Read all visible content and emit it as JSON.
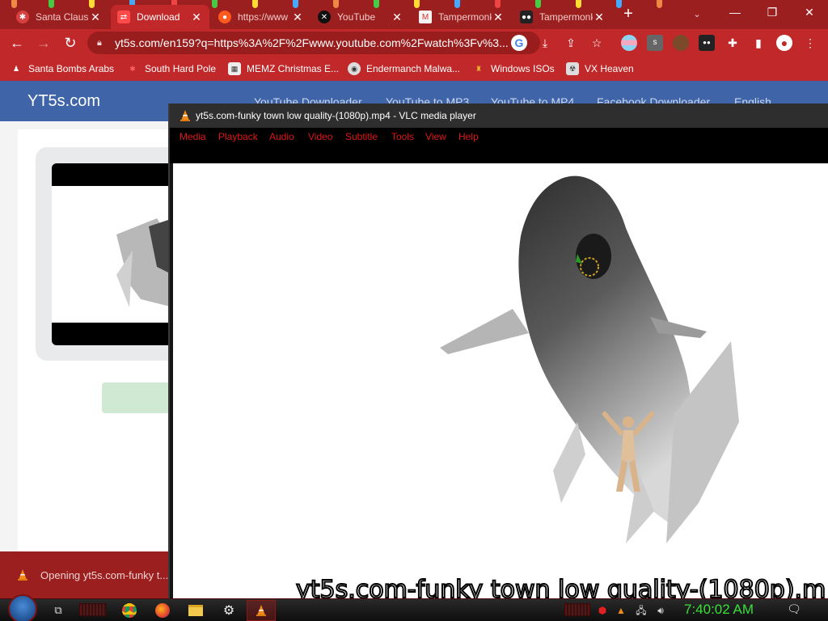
{
  "browser": {
    "tabs": [
      {
        "title": "Santa Claus",
        "icon": "santa-icon",
        "active": false
      },
      {
        "title": "Download",
        "icon": "download-site-icon",
        "active": true
      },
      {
        "title": "https://www",
        "icon": "reddit-icon",
        "active": false
      },
      {
        "title": "YouTube",
        "icon": "youtube-icon",
        "active": false
      },
      {
        "title": "Tampermonkey",
        "icon": "gmail-icon",
        "active": false
      },
      {
        "title": "Tampermonkey",
        "icon": "tampermonkey-icon",
        "active": false
      }
    ],
    "url": "yt5s.com/en159?q=https%3A%2F%2Fwww.youtube.com%2Fwatch%3Fv%3...",
    "bookmarks": [
      {
        "label": "Santa Bombs Arabs"
      },
      {
        "label": "South Hard Pole"
      },
      {
        "label": "MEMZ Christmas E..."
      },
      {
        "label": "Endermanch Malwa..."
      },
      {
        "label": "Windows ISOs"
      },
      {
        "label": "VX Heaven"
      }
    ]
  },
  "site": {
    "logo": "YT5s.com",
    "nav": [
      "YouTube Downloader",
      "YouTube to MP3",
      "YouTube to MP4",
      "Facebook Downloader",
      "English"
    ]
  },
  "download_bar": {
    "text": "Opening yt5s.com-funky t..."
  },
  "vlc": {
    "title": "yt5s.com-funky town low quality-(1080p).mp4 - VLC media player",
    "menu": [
      "Media",
      "Playback",
      "Audio",
      "Video",
      "Subtitle",
      "Tools",
      "View",
      "Help"
    ],
    "subtitle": "yt5s.com-funky town low quality-(1080p).m"
  },
  "taskbar": {
    "clock": "7:40:02 AM"
  },
  "colors": {
    "chrome_dark": "#9c1f1f",
    "chrome": "#c0282a",
    "site_header": "#3f65a8",
    "vlc_menu_text": "#e01616",
    "clock_text": "#38e038"
  }
}
